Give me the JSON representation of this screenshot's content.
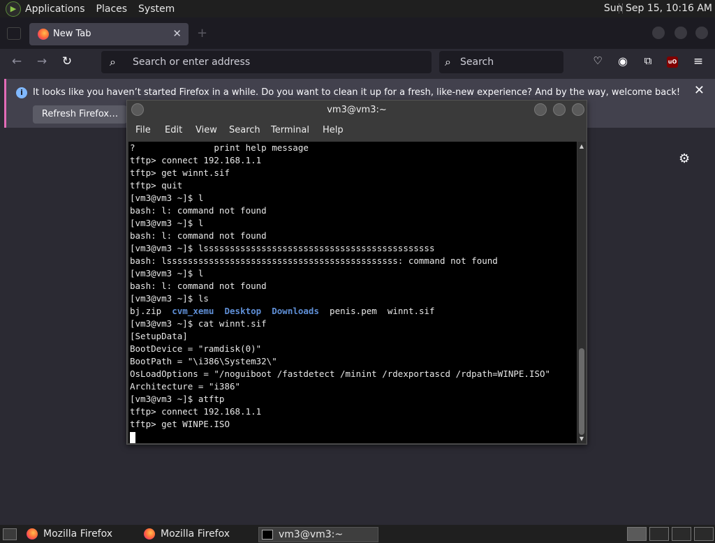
{
  "top_panel": {
    "menus": [
      "Applications",
      "Places",
      "System"
    ],
    "clock": "Sun Sep 15, 10:16 AM"
  },
  "firefox": {
    "tab": {
      "title": "New Tab",
      "close": "✕"
    },
    "url_placeholder": "Search or enter address",
    "search_placeholder": "Search",
    "notification": {
      "message": "It looks like you haven’t started Firefox in a while. Do you want to clean it up for a fresh, like-new experience? And by the way, welcome back!",
      "button": "Refresh Firefox…",
      "close": "✕"
    },
    "ublock_label": "uO"
  },
  "terminal": {
    "title": "vm3@vm3:~",
    "menu": [
      "File",
      "Edit",
      "View",
      "Search",
      "Terminal",
      "Help"
    ],
    "lines": [
      "?               print help message",
      "tftp> connect 192.168.1.1",
      "tftp> get winnt.sif",
      "tftp> quit",
      "[vm3@vm3 ~]$ l",
      "bash: l: command not found",
      "[vm3@vm3 ~]$ l",
      "bash: l: command not found",
      "[vm3@vm3 ~]$ lssssssssssssssssssssssssssssssssssssssssssss",
      "bash: lssssssssssssssssssssssssssssssssssssssssssss: command not found",
      "[vm3@vm3 ~]$ l",
      "bash: l: command not found",
      "[vm3@vm3 ~]$ ls"
    ],
    "ls_output": {
      "file1": "bj.zip",
      "dir1": "cvm_xemu",
      "dir2": "Desktop",
      "dir3": "Downloads",
      "file2": "penis.pem",
      "file3": "winnt.sif"
    },
    "lines_after": [
      "[vm3@vm3 ~]$ cat winnt.sif",
      "[SetupData]",
      "BootDevice = \"ramdisk(0)\"",
      "BootPath = \"\\i386\\System32\\\"",
      "OsLoadOptions = \"/noguiboot /fastdetect /minint /rdexportascd /rdpath=WINPE.ISO\"",
      "Architecture = \"i386\"",
      "[vm3@vm3 ~]$ atftp",
      "tftp> connect 192.168.1.1",
      "tftp> get WINPE.ISO"
    ]
  },
  "taskbar": {
    "items": [
      "Mozilla Firefox",
      "Mozilla Firefox",
      "vm3@vm3:~"
    ]
  }
}
